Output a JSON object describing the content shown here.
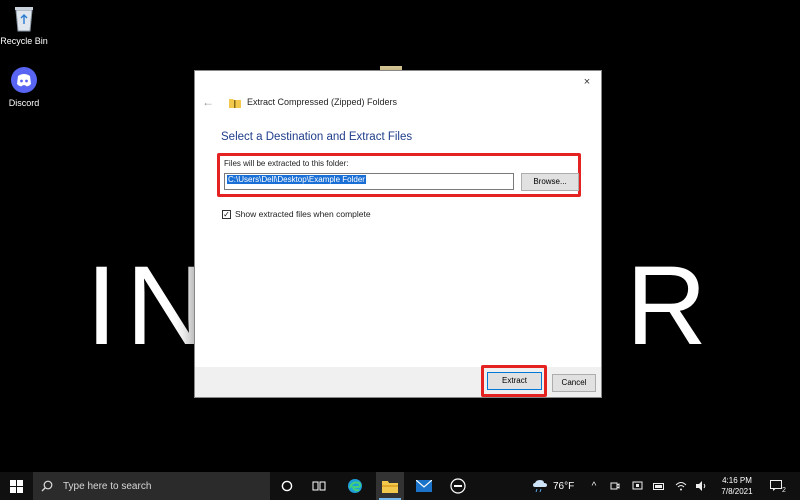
{
  "desktop": {
    "wallpaper_letters": [
      "I",
      "N",
      "R"
    ],
    "icons": [
      {
        "label": "Recycle Bin",
        "icon": "recycle-bin-icon"
      },
      {
        "label": "Discord",
        "icon": "discord-icon"
      }
    ]
  },
  "dialog": {
    "close_label": "×",
    "window_title": "Extract Compressed (Zipped) Folders",
    "heading": "Select a Destination and Extract Files",
    "destination_label": "Files will be extracted to this folder:",
    "destination_value": "C:\\Users\\Dell\\Desktop\\Example Folder",
    "browse_label": "Browse...",
    "show_files_label": "Show extracted files when complete",
    "show_files_checked": true,
    "extract_label": "Extract",
    "cancel_label": "Cancel",
    "highlight_color": "#e52222",
    "heading_color": "#1f3d8a"
  },
  "taskbar": {
    "search_placeholder": "Type here to search",
    "pinned": [
      "task-view-icon",
      "widgets-icon",
      "edge-icon",
      "file-explorer-icon",
      "mail-icon",
      "dell-icon"
    ],
    "weather_temp": "76°F",
    "clock_time": "4:16 PM",
    "clock_date": "7/8/2021",
    "notification_count": "2"
  }
}
